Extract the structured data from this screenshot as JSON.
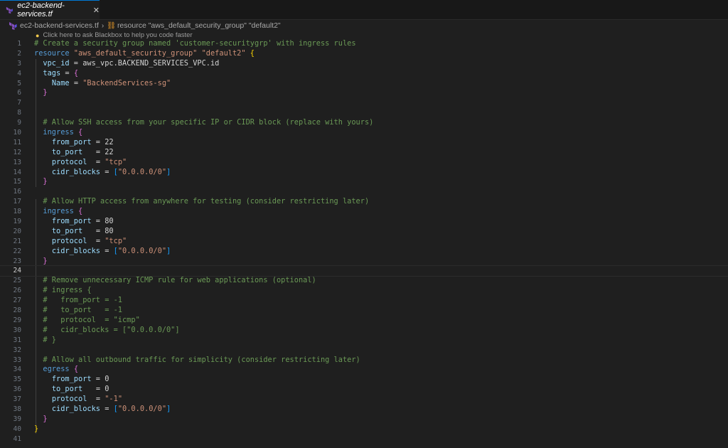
{
  "tab": {
    "title": "ec2-backend-services.tf",
    "close": "✕"
  },
  "breadcrumb": {
    "file": "ec2-backend-services.tf",
    "separator": "›",
    "symbol": "resource \"aws_default_security_group\" \"default2\""
  },
  "hint": "Click here to ask Blackbox to help you code faster",
  "active_line": 24,
  "lines": [
    {
      "n": "1",
      "segs": [
        [
          "c",
          "# Create a security group named 'customer-securitygrp' with ingress rules"
        ]
      ]
    },
    {
      "n": "2",
      "segs": [
        [
          "k",
          "resource "
        ],
        [
          "s",
          "\"aws_default_security_group\" \"default2\" "
        ],
        [
          "b1",
          "{"
        ]
      ]
    },
    {
      "n": "3",
      "segs": [
        [
          "i",
          "  "
        ],
        [
          "v",
          "vpc_id"
        ],
        [
          "i",
          " = aws_vpc.BACKEND_SERVICES_VPC.id"
        ]
      ]
    },
    {
      "n": "4",
      "segs": [
        [
          "i",
          "  "
        ],
        [
          "v",
          "tags"
        ],
        [
          "i",
          " = "
        ],
        [
          "b2",
          "{"
        ]
      ]
    },
    {
      "n": "5",
      "segs": [
        [
          "i",
          "    "
        ],
        [
          "v",
          "Name"
        ],
        [
          "i",
          " = "
        ],
        [
          "s",
          "\"BackendServices-sg\""
        ]
      ]
    },
    {
      "n": "6",
      "segs": [
        [
          "i",
          "  "
        ],
        [
          "b2",
          "}"
        ]
      ]
    },
    {
      "n": "7",
      "segs": []
    },
    {
      "n": "8",
      "segs": []
    },
    {
      "n": "9",
      "segs": [
        [
          "c",
          "  # Allow SSH access from your specific IP or CIDR block (replace with yours)"
        ]
      ]
    },
    {
      "n": "10",
      "segs": [
        [
          "i",
          "  "
        ],
        [
          "k",
          "ingress "
        ],
        [
          "b2",
          "{"
        ]
      ]
    },
    {
      "n": "11",
      "segs": [
        [
          "i",
          "    "
        ],
        [
          "v",
          "from_port"
        ],
        [
          "i",
          " = 22"
        ]
      ]
    },
    {
      "n": "12",
      "segs": [
        [
          "i",
          "    "
        ],
        [
          "v",
          "to_port"
        ],
        [
          "i",
          "   = 22"
        ]
      ]
    },
    {
      "n": "13",
      "segs": [
        [
          "i",
          "    "
        ],
        [
          "v",
          "protocol"
        ],
        [
          "i",
          "  = "
        ],
        [
          "s",
          "\"tcp\""
        ]
      ]
    },
    {
      "n": "14",
      "segs": [
        [
          "i",
          "    "
        ],
        [
          "v",
          "cidr_blocks"
        ],
        [
          "i",
          " = "
        ],
        [
          "b3",
          "["
        ],
        [
          "s",
          "\"0.0.0.0/0\""
        ],
        [
          "b3",
          "]"
        ]
      ]
    },
    {
      "n": "15",
      "segs": [
        [
          "i",
          "  "
        ],
        [
          "b2",
          "}"
        ]
      ]
    },
    {
      "n": "16",
      "segs": []
    },
    {
      "n": "17",
      "segs": [
        [
          "c",
          "  # Allow HTTP access from anywhere for testing (consider restricting later)"
        ]
      ]
    },
    {
      "n": "18",
      "segs": [
        [
          "i",
          "  "
        ],
        [
          "k",
          "ingress "
        ],
        [
          "b2",
          "{"
        ]
      ]
    },
    {
      "n": "19",
      "segs": [
        [
          "i",
          "    "
        ],
        [
          "v",
          "from_port"
        ],
        [
          "i",
          " = 80"
        ]
      ]
    },
    {
      "n": "20",
      "segs": [
        [
          "i",
          "    "
        ],
        [
          "v",
          "to_port"
        ],
        [
          "i",
          "   = 80"
        ]
      ]
    },
    {
      "n": "21",
      "segs": [
        [
          "i",
          "    "
        ],
        [
          "v",
          "protocol"
        ],
        [
          "i",
          "  = "
        ],
        [
          "s",
          "\"tcp\""
        ]
      ]
    },
    {
      "n": "22",
      "segs": [
        [
          "i",
          "    "
        ],
        [
          "v",
          "cidr_blocks"
        ],
        [
          "i",
          " = "
        ],
        [
          "b3",
          "["
        ],
        [
          "s",
          "\"0.0.0.0/0\""
        ],
        [
          "b3",
          "]"
        ]
      ]
    },
    {
      "n": "23",
      "segs": [
        [
          "i",
          "  "
        ],
        [
          "b2",
          "}"
        ]
      ]
    },
    {
      "n": "24",
      "segs": []
    },
    {
      "n": "25",
      "segs": [
        [
          "c",
          "  # Remove unnecessary ICMP rule for web applications (optional)"
        ]
      ]
    },
    {
      "n": "26",
      "segs": [
        [
          "c",
          "  # ingress {"
        ]
      ]
    },
    {
      "n": "27",
      "segs": [
        [
          "c",
          "  #   from_port = -1"
        ]
      ]
    },
    {
      "n": "28",
      "segs": [
        [
          "c",
          "  #   to_port   = -1"
        ]
      ]
    },
    {
      "n": "29",
      "segs": [
        [
          "c",
          "  #   protocol  = \"icmp\""
        ]
      ]
    },
    {
      "n": "30",
      "segs": [
        [
          "c",
          "  #   cidr_blocks = [\"0.0.0.0/0\"]"
        ]
      ]
    },
    {
      "n": "31",
      "segs": [
        [
          "c",
          "  # }"
        ]
      ]
    },
    {
      "n": "32",
      "segs": []
    },
    {
      "n": "33",
      "segs": [
        [
          "c",
          "  # Allow all outbound traffic for simplicity (consider restricting later)"
        ]
      ]
    },
    {
      "n": "34",
      "segs": [
        [
          "i",
          "  "
        ],
        [
          "k",
          "egress "
        ],
        [
          "b2",
          "{"
        ]
      ]
    },
    {
      "n": "35",
      "segs": [
        [
          "i",
          "    "
        ],
        [
          "v",
          "from_port"
        ],
        [
          "i",
          " = 0"
        ]
      ]
    },
    {
      "n": "36",
      "segs": [
        [
          "i",
          "    "
        ],
        [
          "v",
          "to_port"
        ],
        [
          "i",
          "   = 0"
        ]
      ]
    },
    {
      "n": "37",
      "segs": [
        [
          "i",
          "    "
        ],
        [
          "v",
          "protocol"
        ],
        [
          "i",
          "  = "
        ],
        [
          "s",
          "\"-1\""
        ]
      ]
    },
    {
      "n": "38",
      "segs": [
        [
          "i",
          "    "
        ],
        [
          "v",
          "cidr_blocks"
        ],
        [
          "i",
          " = "
        ],
        [
          "b3",
          "["
        ],
        [
          "s",
          "\"0.0.0.0/0\""
        ],
        [
          "b3",
          "]"
        ]
      ]
    },
    {
      "n": "39",
      "segs": [
        [
          "i",
          "  "
        ],
        [
          "b2",
          "}"
        ]
      ]
    },
    {
      "n": "40",
      "segs": [
        [
          "b1",
          "}"
        ]
      ]
    },
    {
      "n": "41",
      "segs": []
    }
  ],
  "colors": {
    "background": "#1f1f1f",
    "comment": "#6a9955",
    "keyword": "#569cd6",
    "string": "#ce9178",
    "attribute": "#9cdcfe",
    "bracket_1": "#ffd700",
    "bracket_2": "#da70d6",
    "bracket_3": "#179fff",
    "tab_accent": "#0078d4"
  },
  "icons": [
    "terraform-icon",
    "close-icon",
    "symbol-icon",
    "lightbulb-icon"
  ]
}
